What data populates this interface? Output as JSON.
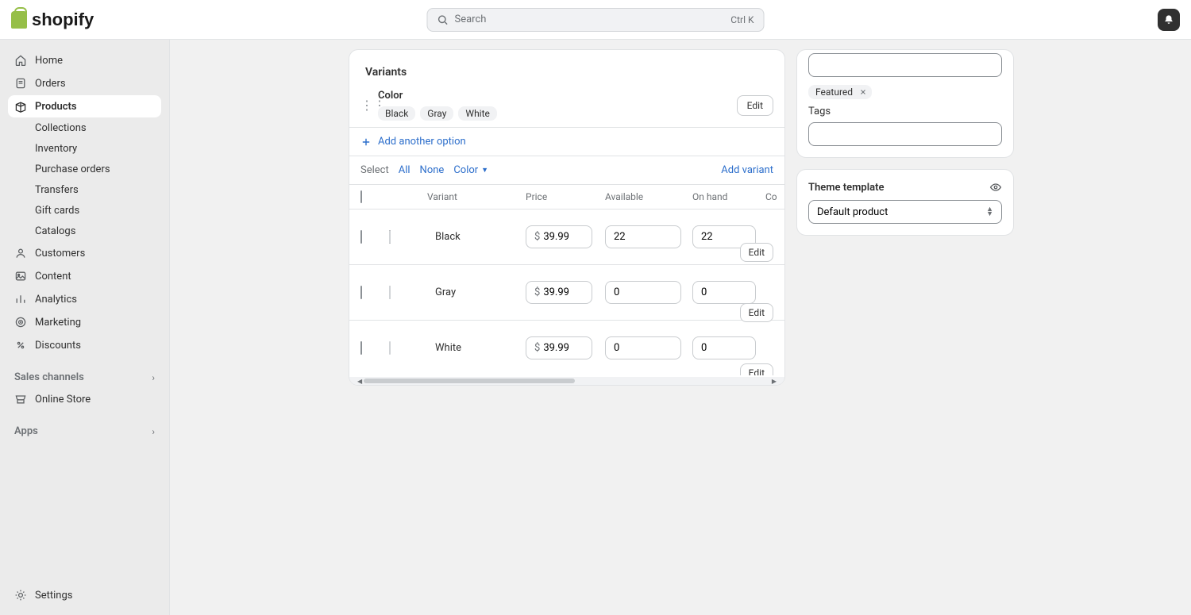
{
  "topbar": {
    "search_placeholder": "Search",
    "kbd_hint": "Ctrl K"
  },
  "sidebar": {
    "home": "Home",
    "orders": "Orders",
    "products": "Products",
    "subnav": {
      "collections": "Collections",
      "inventory": "Inventory",
      "purchase_orders": "Purchase orders",
      "transfers": "Transfers",
      "gift_cards": "Gift cards",
      "catalogs": "Catalogs"
    },
    "customers": "Customers",
    "content": "Content",
    "analytics": "Analytics",
    "marketing": "Marketing",
    "discounts": "Discounts",
    "sales_channels_label": "Sales channels",
    "online_store": "Online Store",
    "apps_label": "Apps",
    "settings": "Settings"
  },
  "variants": {
    "section_title": "Variants",
    "option_name": "Color",
    "option_values": [
      "Black",
      "Gray",
      "White"
    ],
    "edit_option_button": "Edit",
    "add_option_label": "Add another option",
    "select_label": "Select",
    "filter_all": "All",
    "filter_none": "None",
    "filter_color": "Color",
    "add_variant_label": "Add variant",
    "columns": {
      "variant": "Variant",
      "price": "Price",
      "available": "Available",
      "on_hand": "On hand",
      "committed": "Co"
    },
    "currency_symbol": "$",
    "rows": [
      {
        "name": "Black",
        "swatch": "#000000",
        "price": "39.99",
        "available": "22",
        "on_hand": "22",
        "edit_label": "Edit"
      },
      {
        "name": "Gray",
        "swatch": "#b5b5b5",
        "price": "39.99",
        "available": "0",
        "on_hand": "0",
        "edit_label": "Edit"
      },
      {
        "name": "White",
        "swatch": "#ffffff",
        "price": "39.99",
        "available": "0",
        "on_hand": "0",
        "edit_label": "Edit"
      }
    ]
  },
  "right": {
    "featured_tag": "Featured",
    "tags_label": "Tags",
    "theme_template_label": "Theme template",
    "template_value": "Default product"
  }
}
